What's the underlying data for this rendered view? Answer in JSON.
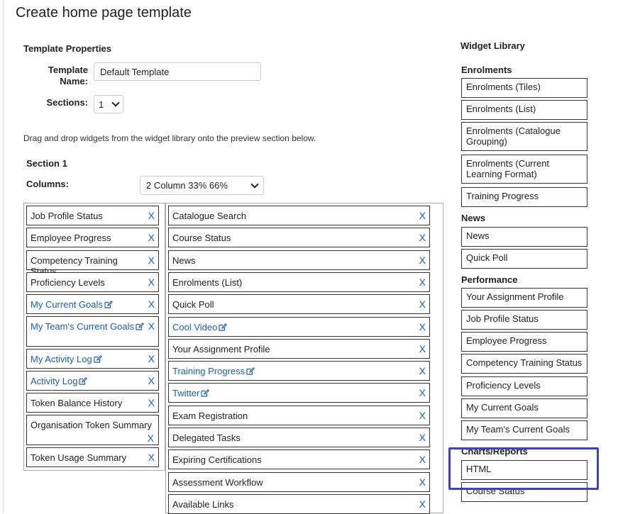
{
  "page": {
    "title": "Create home page template"
  },
  "properties": {
    "heading": "Template Properties",
    "name_label_line1": "Template",
    "name_label_line2": "Name:",
    "name_value": "Default Template",
    "sections_label": "Sections:",
    "sections_value": "1"
  },
  "hint": "Drag and drop widgets from the widget library onto the preview section below.",
  "section": {
    "title": "Section 1",
    "columns_label": "Columns:",
    "columns_value": "2 Column 33% 66%"
  },
  "remove_label": "X",
  "column1": [
    {
      "label": "Job Profile Status",
      "editable": false
    },
    {
      "label": "Employee Progress",
      "editable": false
    },
    {
      "label": "Competency Training Status",
      "editable": false
    },
    {
      "label": "Proficiency Levels",
      "editable": false
    },
    {
      "label": "My Current Goals",
      "editable": true
    },
    {
      "label": "My Team's Current Goals",
      "editable": true
    },
    {
      "label": "My Activity Log",
      "editable": true
    },
    {
      "label": "Activity Log",
      "editable": true
    },
    {
      "label": "Token Balance History",
      "editable": false
    },
    {
      "label": "Organisation Token Summary",
      "editable": false
    },
    {
      "label": "Token Usage Summary",
      "editable": false
    }
  ],
  "column2": [
    {
      "label": "Catalogue Search",
      "editable": false
    },
    {
      "label": "Course Status",
      "editable": false
    },
    {
      "label": "News",
      "editable": false
    },
    {
      "label": "Enrolments (List)",
      "editable": false
    },
    {
      "label": "Quick Poll",
      "editable": false
    },
    {
      "label": "Cool Video",
      "editable": true
    },
    {
      "label": "Your Assignment Profile",
      "editable": false
    },
    {
      "label": "Training Progress",
      "editable": true
    },
    {
      "label": "Twitter",
      "editable": true
    },
    {
      "label": "Exam Registration",
      "editable": false
    },
    {
      "label": "Delegated Tasks",
      "editable": false
    },
    {
      "label": "Expiring Certifications",
      "editable": false
    },
    {
      "label": "Assessment Workflow",
      "editable": false
    },
    {
      "label": "Available Links",
      "editable": false
    }
  ],
  "library": {
    "title": "Widget Library",
    "groups": [
      {
        "name": "Enrolments",
        "items": [
          "Enrolments (Tiles)",
          "Enrolments (List)",
          "Enrolments (Catalogue Grouping)",
          "Enrolments (Current Learning Format)",
          "Training Progress"
        ]
      },
      {
        "name": "News",
        "items": [
          "News",
          "Quick Poll"
        ]
      },
      {
        "name": "Performance",
        "items": [
          "Your Assignment Profile",
          "Job Profile Status",
          "Employee Progress",
          "Competency Training Status",
          "Proficiency Levels",
          "My Current Goals",
          "My Team's Current Goals"
        ]
      },
      {
        "name": "Charts/Reports",
        "items": [
          "HTML",
          "Course Status"
        ]
      }
    ]
  },
  "colors": {
    "link": "#1a5fb4",
    "highlight": "#3b41c8",
    "border": "#333333"
  }
}
